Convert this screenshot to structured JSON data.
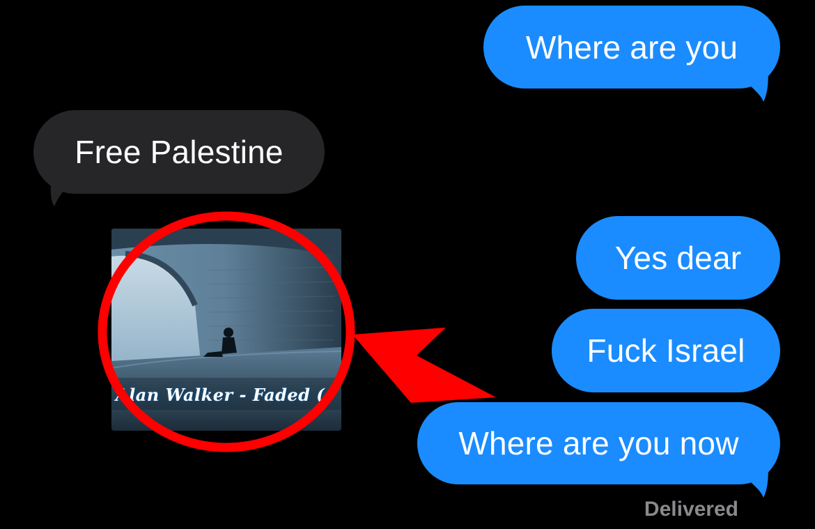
{
  "messages": [
    {
      "id": "m1",
      "direction": "sent",
      "text": "Where are you"
    },
    {
      "id": "m2",
      "direction": "received",
      "text": "Free Palestine"
    },
    {
      "id": "m3",
      "direction": "received",
      "type": "image",
      "caption": "Alan Walker - Faded ("
    },
    {
      "id": "m4",
      "direction": "sent",
      "text": "Yes dear"
    },
    {
      "id": "m5",
      "direction": "sent",
      "text": "Fuck Israel"
    },
    {
      "id": "m6",
      "direction": "sent",
      "text": "Where are you now"
    }
  ],
  "status": {
    "delivered": "Delivered"
  },
  "colors": {
    "sent_bubble": "#1a8cff",
    "received_bubble": "#262628",
    "background": "#000000",
    "annotation": "#ff0000",
    "status_text": "#8a8a8e"
  },
  "annotation": {
    "shapes": [
      "red-circle",
      "red-arrow"
    ]
  }
}
